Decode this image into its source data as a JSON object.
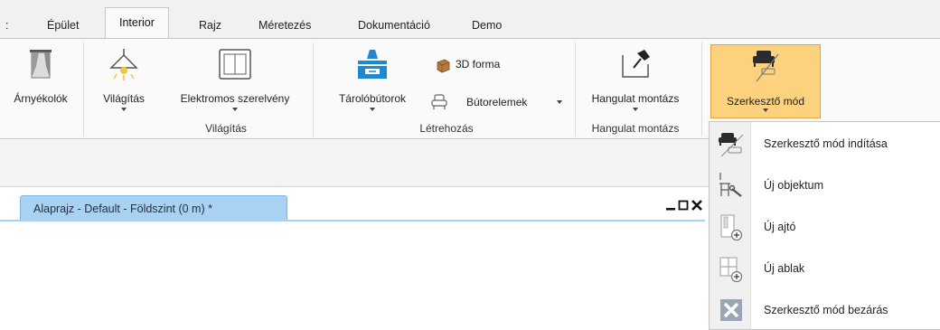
{
  "tabs": [
    {
      "label": ":",
      "active": false
    },
    {
      "label": "Épület",
      "active": false
    },
    {
      "label": "Interior",
      "active": true
    },
    {
      "label": "Rajz",
      "active": false
    },
    {
      "label": "Méretezés",
      "active": false
    },
    {
      "label": "Dokumentáció",
      "active": false
    },
    {
      "label": "Demo",
      "active": false
    }
  ],
  "ribbon": {
    "buttons": {
      "arnyekolok": "Árnyékolók",
      "vilagitas": "Világítás",
      "elektromos": "Elektromos szerelvény",
      "tarolobutorok": "Tárolóbútorok",
      "forma3d": "3D forma",
      "butorelemek": "Bútorelemek",
      "hangulat": "Hangulat montázs",
      "szerkeszto": "Szerkesztő mód"
    },
    "groups": {
      "vilagitas": "Világítás",
      "letrehozas": "Létrehozás",
      "hangulat": "Hangulat montázs"
    }
  },
  "document": {
    "tab_title": "Alaprajz - Default - Földszint (0 m) *"
  },
  "dropdown": {
    "items": [
      {
        "label": "Szerkesztő mód indítása",
        "icon": "sofa-edit-icon"
      },
      {
        "label": "Új objektum",
        "icon": "new-object-icon"
      },
      {
        "label": "Új ajtó",
        "icon": "new-door-icon"
      },
      {
        "label": "Új ablak",
        "icon": "new-window-icon"
      },
      {
        "label": "Szerkesztő mód bezárás",
        "icon": "close-x-icon"
      }
    ]
  },
  "colors": {
    "active_button": "#fcd27e",
    "active_button_border": "#e0a43c",
    "doc_tab": "#a9d2f2",
    "accent_blue": "#1e88d2"
  }
}
